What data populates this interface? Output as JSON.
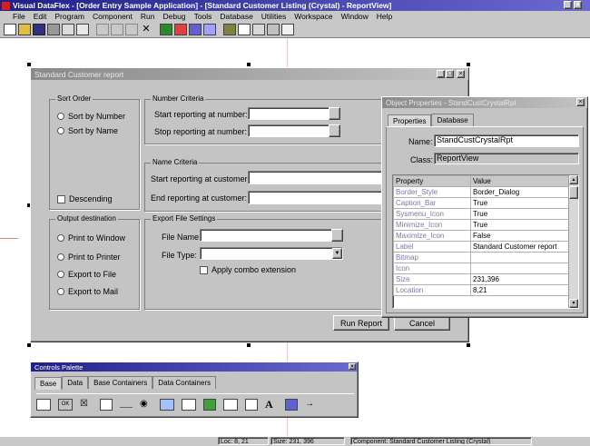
{
  "app": {
    "title": "Visual DataFlex - [Order Entry Sample Application] - [Standard Customer Listing (Crystal) - ReportView]",
    "menu": [
      "File",
      "Edit",
      "Program",
      "Component",
      "Run",
      "Debug",
      "Tools",
      "Database",
      "Utilities",
      "Workspace",
      "Window",
      "Help"
    ]
  },
  "report_window": {
    "title": "Standard Customer report",
    "sort_order": {
      "label": "Sort Order",
      "options": [
        "Sort by Number",
        "Sort by Name"
      ],
      "descending": "Descending"
    },
    "number_criteria": {
      "label": "Number Criteria",
      "start": "Start reporting at number:",
      "stop": "Stop reporting at number:"
    },
    "name_criteria": {
      "label": "Name Criteria",
      "start": "Start reporting at customer:",
      "end": "End reporting at customer:"
    },
    "output": {
      "label": "Output destination",
      "options": [
        "Print to Window",
        "Print to Printer",
        "Export to File",
        "Export to Mail"
      ]
    },
    "export_settings": {
      "label": "Export File Settings",
      "file_name": "File Name:",
      "file_type": "File Type:",
      "apply_combo": "Apply combo extension"
    },
    "run_button": "Run Report",
    "cancel_button": "Cancel"
  },
  "properties": {
    "title": "Object Properties - StandCustCrystalRpt",
    "tabs": [
      "Properties",
      "Database"
    ],
    "name_label": "Name:",
    "name_value": "StandCustCrystalRpt",
    "class_label": "Class:",
    "class_value": "ReportView",
    "header": [
      "Property",
      "Value"
    ],
    "rows": [
      [
        "Border_Style",
        "Border_Dialog"
      ],
      [
        "Caption_Bar",
        "True"
      ],
      [
        "Sysmenu_Icon",
        "True"
      ],
      [
        "Minimize_Icon",
        "True"
      ],
      [
        "Maximize_Icon",
        "False"
      ],
      [
        "Label",
        "Standard Customer report"
      ],
      [
        "Bitmap",
        ""
      ],
      [
        "Icon",
        ""
      ],
      [
        "Size",
        "231,396"
      ],
      [
        "Location",
        "8,21"
      ]
    ]
  },
  "palette": {
    "title": "Controls Palette",
    "tabs": [
      "Base",
      "Data",
      "Base Containers",
      "Data Containers"
    ],
    "icons": [
      "entry-icon",
      "ok-button-icon",
      "checkbox-icon",
      "list-icon",
      "line-icon",
      "radio-icon",
      "form-icon",
      "grid-icon",
      "image-icon",
      "edit-icon",
      "spin-icon",
      "text-icon",
      "color-icon",
      "tab-order-icon"
    ]
  },
  "status": {
    "loc": "Loc: 8, 21",
    "size": "Size: 231, 396",
    "component": "Component: Standard Customer Listing (Crystal)"
  },
  "colors": {
    "title_active": "#20208a",
    "face": "#c4c4c4",
    "workspace": "#ffffff"
  }
}
